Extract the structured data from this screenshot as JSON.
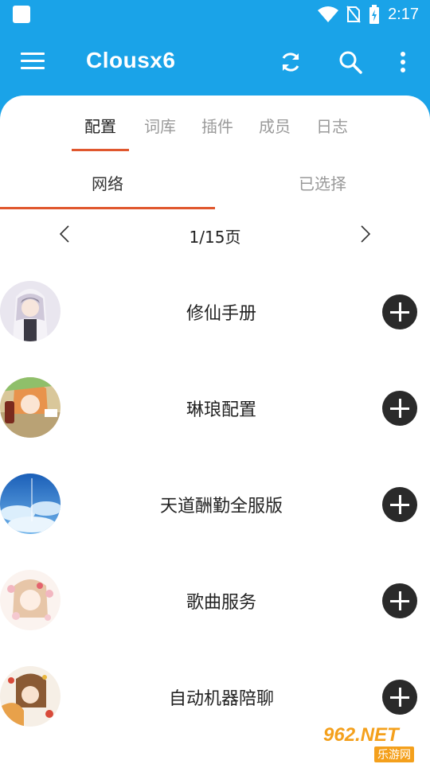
{
  "status_bar": {
    "time": "2:17",
    "icons": [
      "notification-square-icon",
      "wifi-icon",
      "no-sim-icon",
      "battery-charging-icon"
    ]
  },
  "app_bar": {
    "title": "Clousx6",
    "icons": [
      "menu-icon",
      "refresh-icon",
      "search-icon",
      "more-vert-icon"
    ],
    "color": "#1aa3e8"
  },
  "tabs": [
    {
      "label": "配置",
      "active": true
    },
    {
      "label": "词库",
      "active": false
    },
    {
      "label": "插件",
      "active": false
    },
    {
      "label": "成员",
      "active": false
    },
    {
      "label": "日志",
      "active": false
    }
  ],
  "subtabs": [
    {
      "label": "网络",
      "active": true
    },
    {
      "label": "已选择",
      "active": false
    }
  ],
  "accent_color": "#e0572e",
  "pager": {
    "text": "1/15页",
    "prev_icon": "chevron-left-icon",
    "next_icon": "chevron-right-icon"
  },
  "items": [
    {
      "title": "修仙手册",
      "avatar": "anime-girl-white-hair-avatar"
    },
    {
      "title": "琳琅配置",
      "avatar": "anime-girl-cola-avatar"
    },
    {
      "title": "天道酬勤全服版",
      "avatar": "blue-sky-avatar"
    },
    {
      "title": "歌曲服务",
      "avatar": "anime-girl-pink-flowers-avatar"
    },
    {
      "title": "自动机器陪聊",
      "avatar": "anime-couple-flowers-avatar"
    }
  ],
  "watermark": {
    "main": "962.NET",
    "sub": "乐游网"
  }
}
